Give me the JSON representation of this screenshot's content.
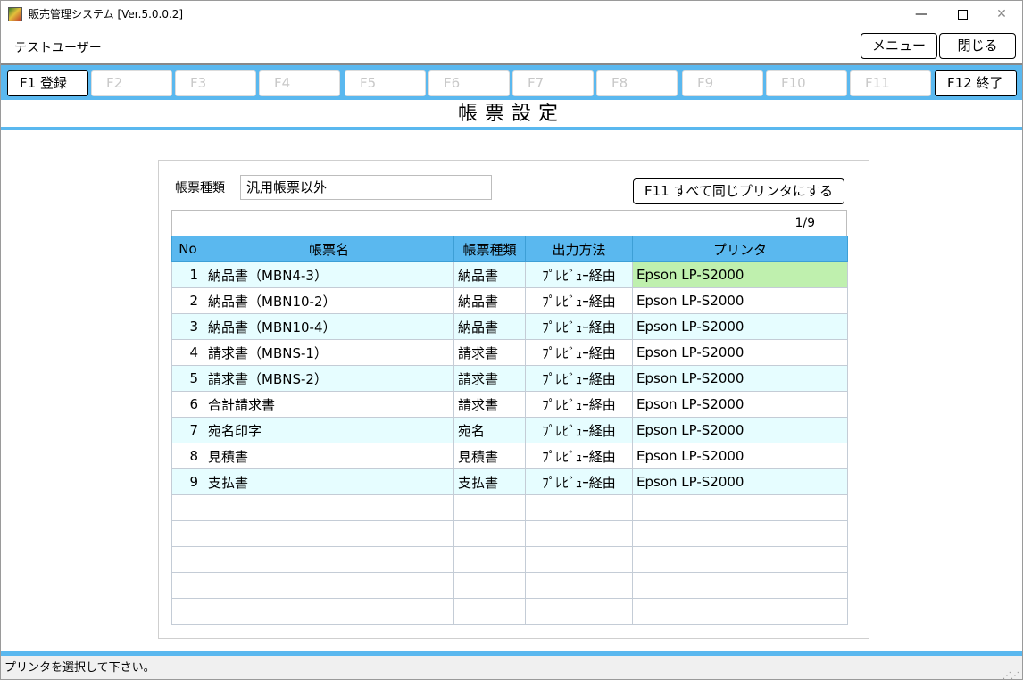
{
  "window": {
    "title": "販売管理システム [Ver.5.0.0.2]",
    "minimize": "—",
    "close": "✕"
  },
  "header": {
    "user_name": "テストユーザー",
    "menu_label": "メニュー",
    "close_label": "閉じる"
  },
  "fkeys": [
    {
      "label": "F1 登録",
      "enabled": true
    },
    {
      "label": "F2",
      "enabled": false
    },
    {
      "label": "F3",
      "enabled": false
    },
    {
      "label": "F4",
      "enabled": false
    },
    {
      "label": "F5",
      "enabled": false
    },
    {
      "label": "F6",
      "enabled": false
    },
    {
      "label": "F7",
      "enabled": false
    },
    {
      "label": "F8",
      "enabled": false
    },
    {
      "label": "F9",
      "enabled": false
    },
    {
      "label": "F10",
      "enabled": false
    },
    {
      "label": "F11",
      "enabled": false
    },
    {
      "label": "F12 終了",
      "enabled": true
    }
  ],
  "page_title": "帳票設定",
  "filter": {
    "label": "帳票種類",
    "value": "汎用帳票以外"
  },
  "same_printer_button": "F11 すべて同じプリンタにする",
  "pager": "1/9",
  "table": {
    "columns": [
      "No",
      "帳票名",
      "帳票種類",
      "出力方法",
      "プリンタ"
    ],
    "rows": [
      {
        "no": "1",
        "name": "納品書（MBN4-3）",
        "type": "納品書",
        "method": "ﾌﾟﾚﾋﾞｭｰ経由",
        "printer": "Epson LP-S2000"
      },
      {
        "no": "2",
        "name": "納品書（MBN10-2）",
        "type": "納品書",
        "method": "ﾌﾟﾚﾋﾞｭｰ経由",
        "printer": "Epson LP-S2000"
      },
      {
        "no": "3",
        "name": "納品書（MBN10-4）",
        "type": "納品書",
        "method": "ﾌﾟﾚﾋﾞｭｰ経由",
        "printer": "Epson LP-S2000"
      },
      {
        "no": "4",
        "name": "請求書（MBNS-1）",
        "type": "請求書",
        "method": "ﾌﾟﾚﾋﾞｭｰ経由",
        "printer": "Epson LP-S2000"
      },
      {
        "no": "5",
        "name": "請求書（MBNS-2）",
        "type": "請求書",
        "method": "ﾌﾟﾚﾋﾞｭｰ経由",
        "printer": "Epson LP-S2000"
      },
      {
        "no": "6",
        "name": "合計請求書",
        "type": "請求書",
        "method": "ﾌﾟﾚﾋﾞｭｰ経由",
        "printer": "Epson LP-S2000"
      },
      {
        "no": "7",
        "name": "宛名印字",
        "type": "宛名",
        "method": "ﾌﾟﾚﾋﾞｭｰ経由",
        "printer": "Epson LP-S2000"
      },
      {
        "no": "8",
        "name": "見積書",
        "type": "見積書",
        "method": "ﾌﾟﾚﾋﾞｭｰ経由",
        "printer": "Epson LP-S2000"
      },
      {
        "no": "9",
        "name": "支払書",
        "type": "支払書",
        "method": "ﾌﾟﾚﾋﾞｭｰ経由",
        "printer": "Epson LP-S2000"
      }
    ],
    "selected_row": 0
  },
  "status": "プリンタを選択して下さい。",
  "colors": {
    "accent": "#5ab8ef",
    "row_alt": "#e6fdff",
    "selected_cell": "#bff0ae",
    "disabled_text": "#c8c8c8"
  }
}
